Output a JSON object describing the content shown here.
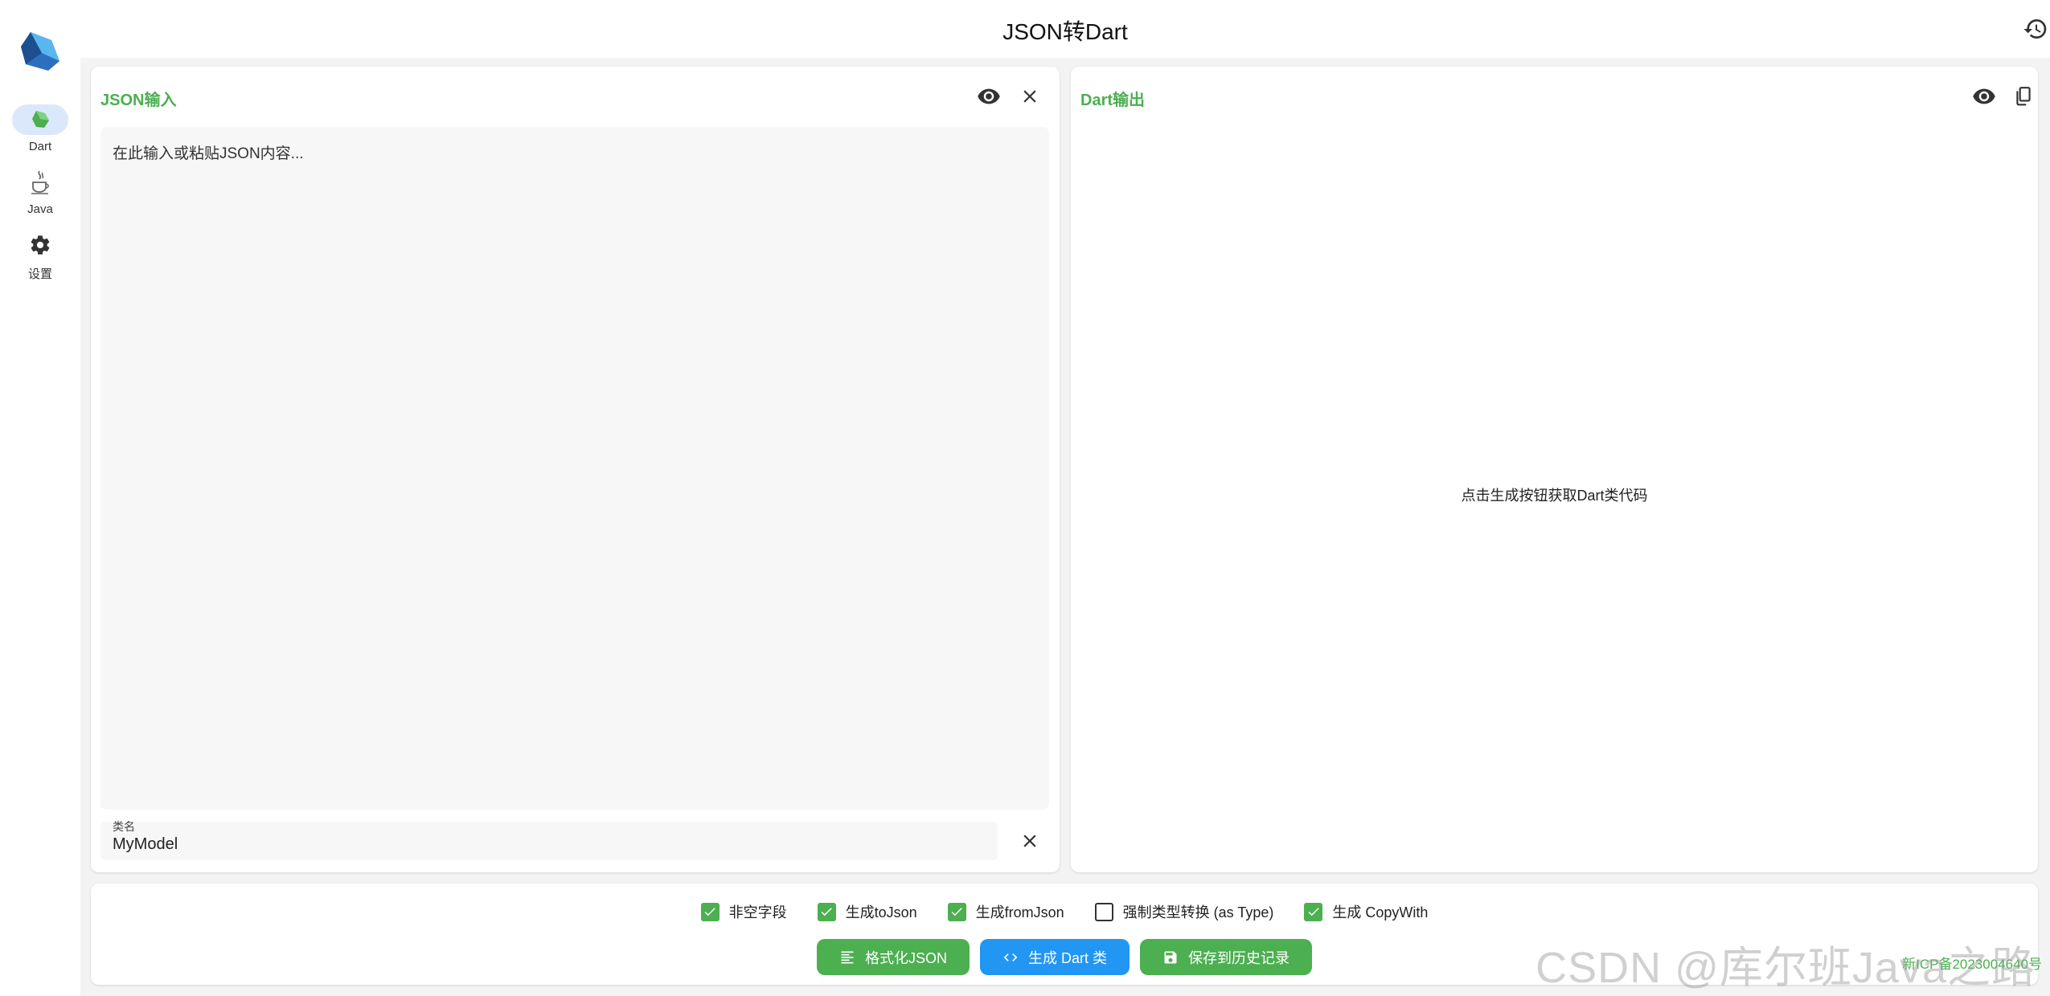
{
  "app": {
    "title": "JSON转Dart"
  },
  "sidebar": {
    "items": [
      {
        "label": "Dart",
        "icon": "dart-icon",
        "active": true
      },
      {
        "label": "Java",
        "icon": "java-cup-icon",
        "active": false
      },
      {
        "label": "设置",
        "icon": "gear-icon",
        "active": false
      }
    ]
  },
  "input_panel": {
    "title": "JSON输入",
    "placeholder": "在此输入或粘贴JSON内容...",
    "class_name_label": "类名",
    "class_name_value": "MyModel"
  },
  "output_panel": {
    "title": "Dart输出",
    "placeholder": "点击生成按钮获取Dart类代码"
  },
  "options": [
    {
      "label": "非空字段",
      "checked": true
    },
    {
      "label": "生成toJson",
      "checked": true
    },
    {
      "label": "生成fromJson",
      "checked": true
    },
    {
      "label": "强制类型转换 (as Type)",
      "checked": false
    },
    {
      "label": "生成 CopyWith",
      "checked": true
    }
  ],
  "actions": {
    "format_label": "格式化JSON",
    "generate_label": "生成 Dart 类",
    "save_label": "保存到历史记录"
  },
  "footer": {
    "icp": "新ICP备2023004640号",
    "watermark": "CSDN @库尔班Java之路"
  },
  "colors": {
    "accent_green": "#4caf50",
    "accent_blue": "#2196f3",
    "nav_active": "#dbe7fb"
  }
}
